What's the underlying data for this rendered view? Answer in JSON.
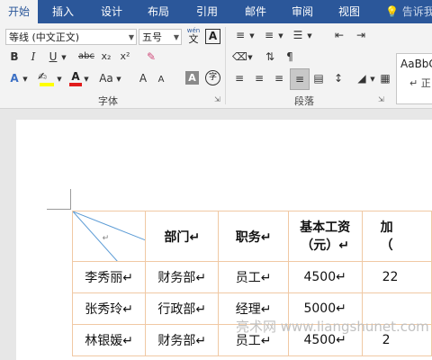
{
  "tabs": [
    "开始",
    "插入",
    "设计",
    "布局",
    "引用",
    "邮件",
    "审阅",
    "视图"
  ],
  "tell_me": "告诉我",
  "font": {
    "family": "等线 (中文正文)",
    "size": "五号",
    "phonetic_top": "wén",
    "phonetic_char": "文",
    "border_char": "A"
  },
  "groups": {
    "font": "字体",
    "paragraph": "段落"
  },
  "styles_preview": {
    "sample": "AaBbC",
    "name": "↵ 正"
  },
  "format_buttons": {
    "bold": "B",
    "italic": "I",
    "underline": "U",
    "strike": "abc",
    "subscript": "x₂",
    "superscript": "x²",
    "effects": "A",
    "font_color": "A",
    "change_case": "Aa",
    "grow": "A",
    "shrink": "A",
    "shading": "A",
    "enclose": "字"
  },
  "table": {
    "header": [
      "↵",
      "部门↵",
      "职务↵",
      "基本工资（元）↵",
      "加"
    ],
    "header_wage_line1": "基本工资",
    "header_wage_line2": "（元）↵",
    "header_add_line2": "（",
    "rows": [
      [
        "李秀丽↵",
        "财务部↵",
        "员工↵",
        "4500↵",
        "22"
      ],
      [
        "张秀玲↵",
        "行政部↵",
        "经理↵",
        "5000↵",
        ""
      ],
      [
        "林银媛↵",
        "财务部↵",
        "员工↵",
        "4500↵",
        "2"
      ]
    ]
  },
  "watermark": "亮术网 www.liangshunet.com"
}
